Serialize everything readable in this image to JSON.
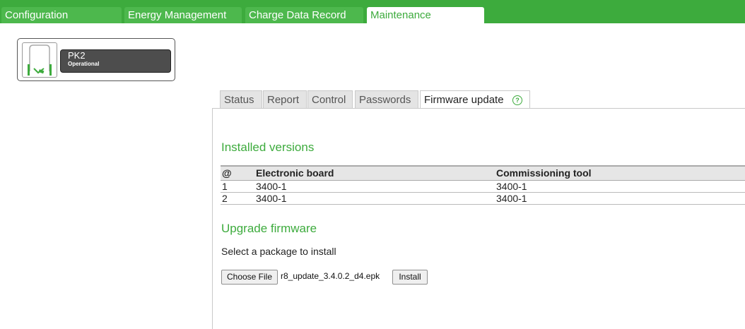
{
  "topnav": {
    "tabs": [
      {
        "label": "Configuration"
      },
      {
        "label": "Energy Management"
      },
      {
        "label": "Charge Data Record"
      },
      {
        "label": "Maintenance"
      }
    ],
    "active_tab": "Maintenance",
    "colors": {
      "bar": "#3dab3d",
      "tab": "#4db84d",
      "active_text": "#3dab3d"
    }
  },
  "station": {
    "name": "PK2",
    "status": "Operational",
    "icon": "charging-station-icon"
  },
  "subtabs": {
    "tabs": [
      {
        "label": "Status"
      },
      {
        "label": "Report"
      },
      {
        "label": "Control"
      },
      {
        "label": "Passwords"
      },
      {
        "label": "Firmware update"
      }
    ],
    "active_tab": "Firmware update",
    "help_icon": "help-icon",
    "help_glyph": "?"
  },
  "installed": {
    "title": "Installed versions",
    "columns": [
      "@",
      "Electronic board",
      "Commissioning tool"
    ],
    "rows": [
      {
        "at": "1",
        "board": "3400-1",
        "tool": "3400-1"
      },
      {
        "at": "2",
        "board": "3400-1",
        "tool": "3400-1"
      }
    ]
  },
  "upgrade": {
    "title": "Upgrade firmware",
    "instruction": "Select a package to install",
    "choose_file_label": "Choose File",
    "file_name": "r8_update_3.4.0.2_d4.epk",
    "install_label": "Install"
  }
}
